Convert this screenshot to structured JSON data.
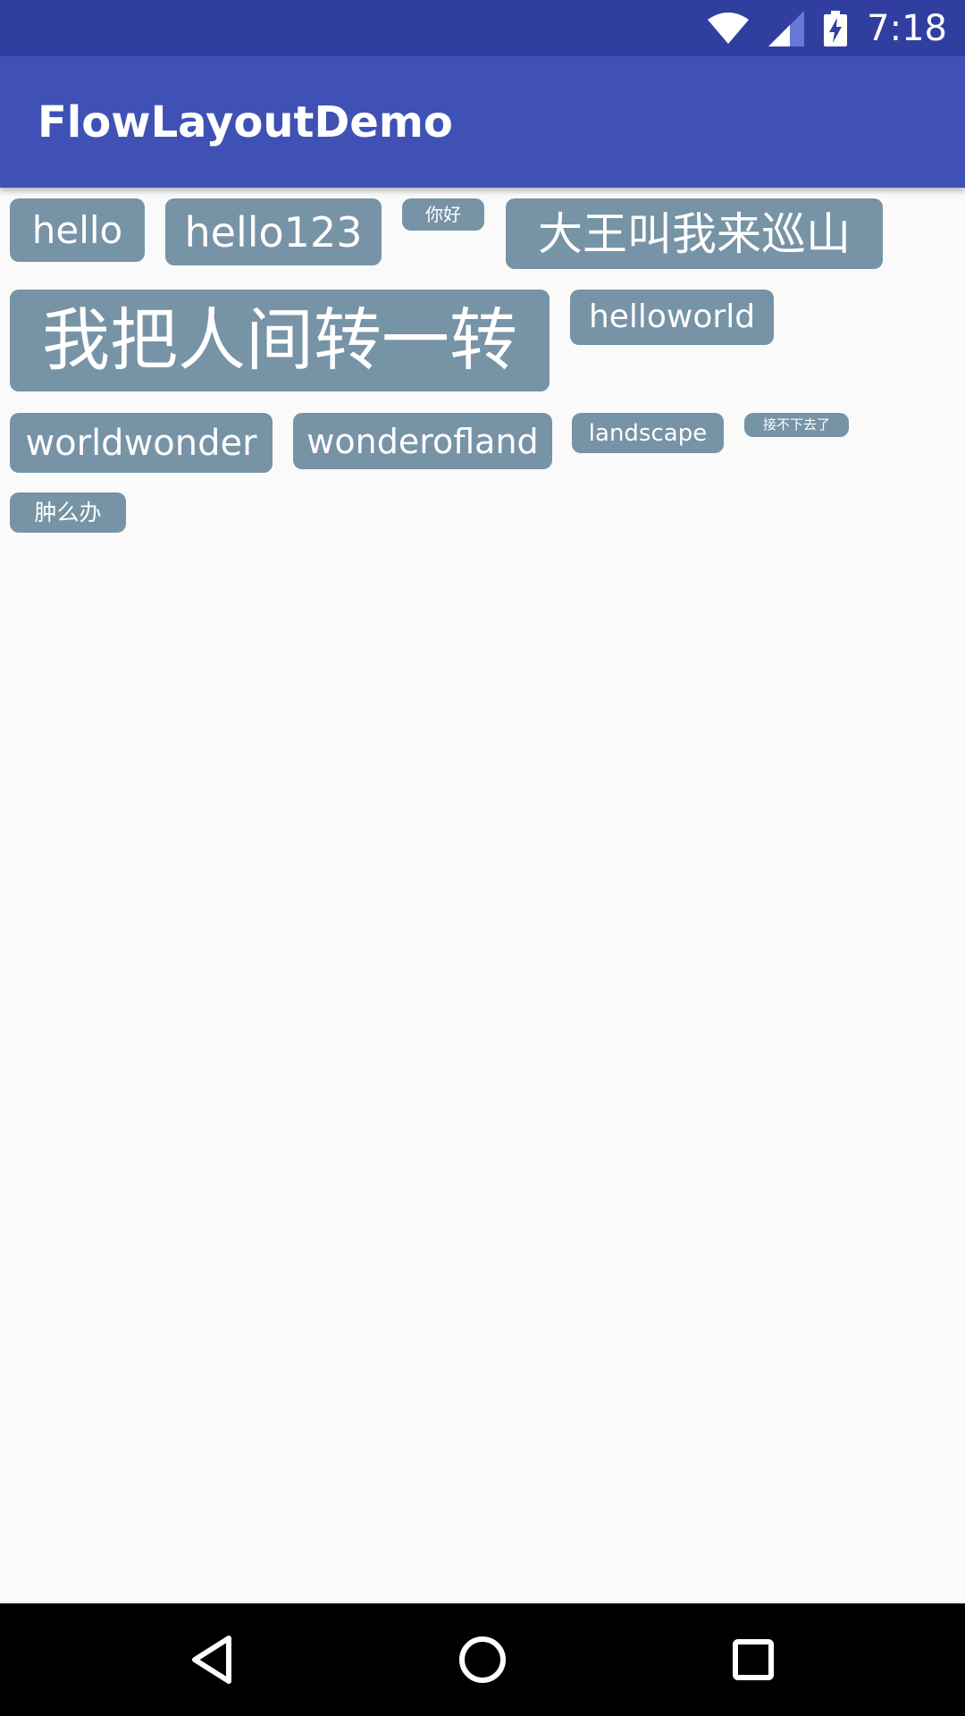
{
  "status_bar": {
    "time": "7:18",
    "icons": [
      "wifi-icon",
      "cell-signal-icon",
      "battery-charging-icon"
    ]
  },
  "app_bar": {
    "title": "FlowLayoutDemo"
  },
  "tags": [
    "hello",
    "hello123",
    "你好",
    "大王叫我来巡山",
    "我把人间转一转",
    "helloworld",
    "worldwonder",
    "wonderofland",
    "landscape",
    "接不下去了",
    "肿么办"
  ],
  "nav_bar": {
    "icons": [
      "back-icon",
      "home-icon",
      "recents-icon"
    ]
  },
  "colors": {
    "status_bar": "#303f9f",
    "app_bar": "#3f51b5",
    "tag_background": "#7793a6",
    "page_background": "#fafafa"
  }
}
